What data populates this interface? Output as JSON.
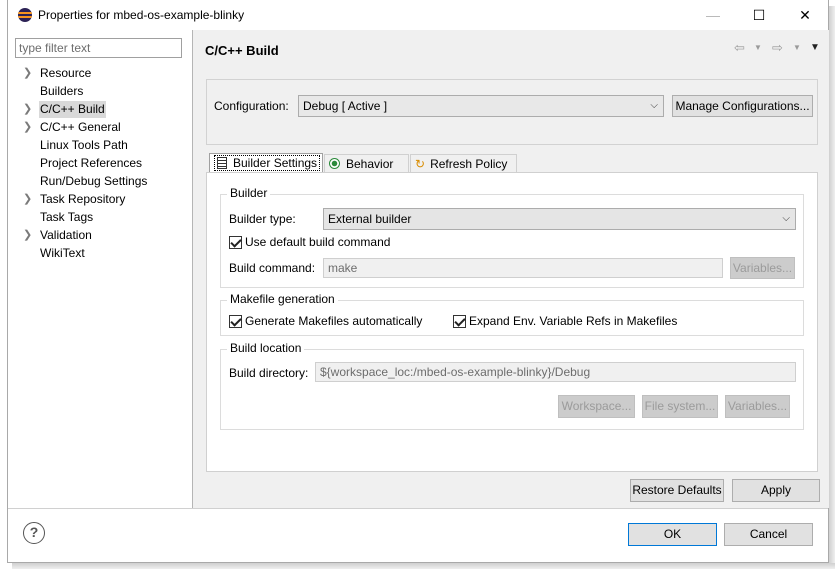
{
  "window": {
    "title": "Properties for mbed-os-example-blinky",
    "minimize": "—",
    "maximize": "☐",
    "close": "✕"
  },
  "left": {
    "filter_placeholder": "type filter text",
    "tree": [
      {
        "label": "Resource",
        "expandable": true,
        "selected": false
      },
      {
        "label": "Builders",
        "expandable": false,
        "selected": false
      },
      {
        "label": "C/C++ Build",
        "expandable": true,
        "selected": true
      },
      {
        "label": "C/C++ General",
        "expandable": true,
        "selected": false
      },
      {
        "label": "Linux Tools Path",
        "expandable": false,
        "selected": false
      },
      {
        "label": "Project References",
        "expandable": false,
        "selected": false
      },
      {
        "label": "Run/Debug Settings",
        "expandable": false,
        "selected": false
      },
      {
        "label": "Task Repository",
        "expandable": true,
        "selected": false
      },
      {
        "label": "Task Tags",
        "expandable": false,
        "selected": false
      },
      {
        "label": "Validation",
        "expandable": true,
        "selected": false
      },
      {
        "label": "WikiText",
        "expandable": false,
        "selected": false
      }
    ]
  },
  "page": {
    "title": "C/C++ Build",
    "configuration_label": "Configuration:",
    "configuration_value": "Debug  [ Active ]",
    "manage_configurations": "Manage Configurations..."
  },
  "tabs": [
    {
      "label": "Builder Settings",
      "icon": "list-icon",
      "active": true
    },
    {
      "label": "Behavior",
      "icon": "radio-icon",
      "active": false
    },
    {
      "label": "Refresh Policy",
      "icon": "refresh-icon",
      "active": false
    }
  ],
  "builder": {
    "group_title": "Builder",
    "type_label": "Builder type:",
    "type_value": "External builder",
    "use_default_label": "Use default build command",
    "use_default_checked": true,
    "command_label": "Build command:",
    "command_value": "make",
    "variables_button": "Variables..."
  },
  "makefile": {
    "group_title": "Makefile generation",
    "generate_label": "Generate Makefiles automatically",
    "generate_checked": true,
    "expand_label": "Expand Env. Variable Refs in Makefiles",
    "expand_checked": true
  },
  "location": {
    "group_title": "Build location",
    "directory_label": "Build directory:",
    "directory_value": "${workspace_loc:/mbed-os-example-blinky}/Debug",
    "workspace_button": "Workspace...",
    "filesystem_button": "File system...",
    "variables_button": "Variables..."
  },
  "footer": {
    "restore_defaults": "Restore Defaults",
    "apply": "Apply",
    "ok": "OK",
    "cancel": "Cancel",
    "help": "?"
  }
}
